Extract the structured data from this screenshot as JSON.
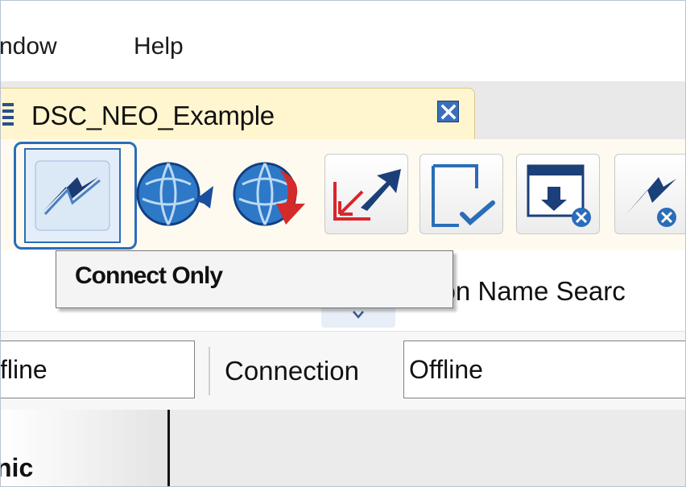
{
  "menubar": {
    "items": [
      "ndow",
      "Help"
    ]
  },
  "document_tab": {
    "title": "DSC_NEO_Example",
    "close_icon": "close-x-icon"
  },
  "toolbar": {
    "buttons": [
      {
        "name": "connect-only",
        "icon": "connect-lightning-icon",
        "selected": true
      },
      {
        "name": "upload-globe",
        "icon": "globe-blue-arrow-icon"
      },
      {
        "name": "download-globe",
        "icon": "globe-red-arrow-icon"
      },
      {
        "name": "import-export",
        "icon": "import-export-arrows-icon"
      },
      {
        "name": "check-document",
        "icon": "document-check-icon"
      },
      {
        "name": "cancel-download",
        "icon": "window-download-cancel-icon"
      },
      {
        "name": "disconnect",
        "icon": "disconnect-lightning-icon"
      }
    ]
  },
  "tooltip": {
    "text": "Connect Only"
  },
  "search": {
    "label": "tion Name Searc"
  },
  "status_row": {
    "field1_value": "fline",
    "connection_label": "Connection",
    "connection_value": "Offline"
  },
  "grid": {
    "header_label": "nic"
  },
  "colors": {
    "accent": "#2a6db8",
    "tab_bg": "#fff6cf",
    "toolbar_bg": "#fffaf0"
  }
}
